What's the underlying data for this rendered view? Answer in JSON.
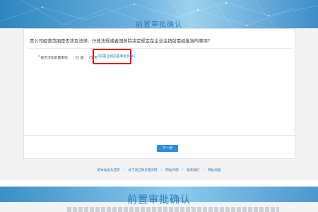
{
  "page": {
    "title": "前置审批确认"
  },
  "form": {
    "question": "贵公司经营范围是否涉及法律、行政法规或者国务院决定规定在企业注销前需经批准的事项？",
    "field_label": "是否涉及前置审批：",
    "required_mark": "*",
    "radio_yes": "是",
    "radio_no": "否",
    "link": "《前置注销前置审批目录》",
    "next_button": "下一步"
  },
  "footer": {
    "links": [
      "把本站设为首页",
      "关于浙江政务服务网",
      "网站声明",
      "联系我们",
      "网站地图"
    ]
  },
  "colors": {
    "accent": "#2a7dc0",
    "button": "#2e8ede",
    "highlight": "#e3131b"
  }
}
